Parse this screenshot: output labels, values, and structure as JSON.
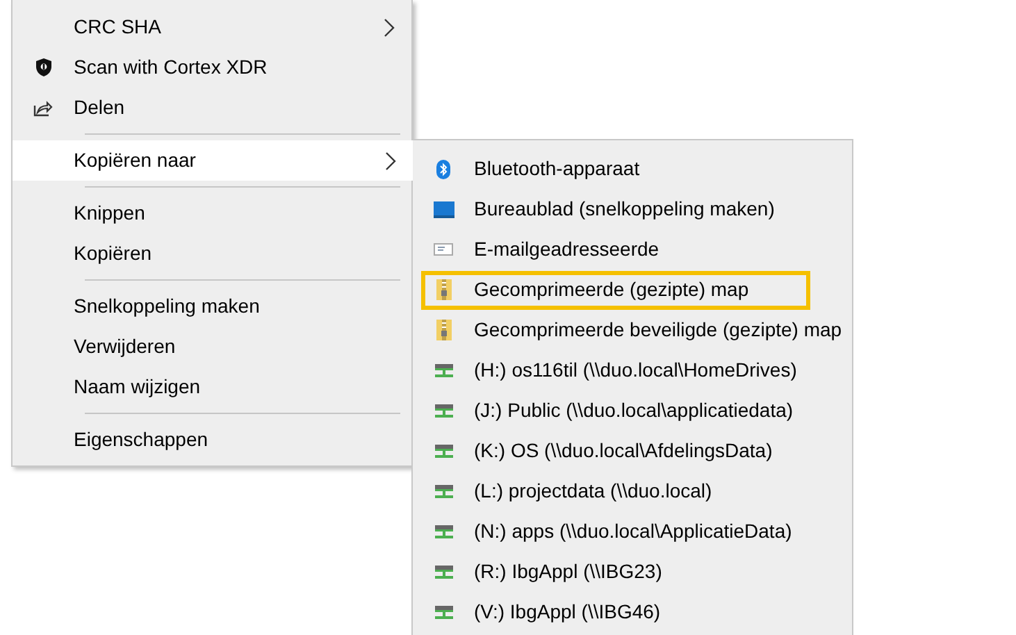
{
  "context_menu": {
    "items": [
      {
        "kind": "plain",
        "label": "CRC SHA",
        "submenu": true,
        "selected": false
      },
      {
        "kind": "shield",
        "label": "Scan with Cortex XDR",
        "submenu": false,
        "selected": false
      },
      {
        "kind": "share",
        "label": "Delen",
        "submenu": false,
        "selected": false
      },
      {
        "kind": "separator"
      },
      {
        "kind": "plain",
        "label": "Kopiëren naar",
        "submenu": true,
        "selected": true
      },
      {
        "kind": "separator"
      },
      {
        "kind": "plain",
        "label": "Knippen",
        "submenu": false,
        "selected": false
      },
      {
        "kind": "plain",
        "label": "Kopiëren",
        "submenu": false,
        "selected": false
      },
      {
        "kind": "separator"
      },
      {
        "kind": "plain",
        "label": "Snelkoppeling maken",
        "submenu": false,
        "selected": false
      },
      {
        "kind": "plain",
        "label": "Verwijderen",
        "submenu": false,
        "selected": false
      },
      {
        "kind": "plain",
        "label": "Naam wijzigen",
        "submenu": false,
        "selected": false
      },
      {
        "kind": "separator"
      },
      {
        "kind": "plain",
        "label": "Eigenschappen",
        "submenu": false,
        "selected": false
      }
    ]
  },
  "submenu": {
    "items": [
      {
        "kind": "bluetooth",
        "label": "Bluetooth-apparaat",
        "outlined": false
      },
      {
        "kind": "desktop",
        "label": "Bureaublad (snelkoppeling maken)",
        "outlined": false
      },
      {
        "kind": "mail",
        "label": "E-mailgeadresseerde",
        "outlined": false
      },
      {
        "kind": "zip",
        "label": "Gecomprimeerde (gezipte) map",
        "outlined": true
      },
      {
        "kind": "zip",
        "label": "Gecomprimeerde beveiligde (gezipte) map",
        "outlined": false
      },
      {
        "kind": "drive",
        "label": "(H:) os116til (\\\\duo.local\\HomeDrives)",
        "outlined": false
      },
      {
        "kind": "drive",
        "label": "(J:) Public (\\\\duo.local\\applicatiedata)",
        "outlined": false
      },
      {
        "kind": "drive",
        "label": "(K:) OS (\\\\duo.local\\AfdelingsData)",
        "outlined": false
      },
      {
        "kind": "drive",
        "label": "(L:) projectdata (\\\\duo.local)",
        "outlined": false
      },
      {
        "kind": "drive",
        "label": "(N:) apps (\\\\duo.local\\ApplicatieData)",
        "outlined": false
      },
      {
        "kind": "drive",
        "label": "(R:) IbgAppl (\\\\IBG23)",
        "outlined": false
      },
      {
        "kind": "drive",
        "label": "(V:) IbgAppl (\\\\IBG46)",
        "outlined": false
      }
    ]
  }
}
